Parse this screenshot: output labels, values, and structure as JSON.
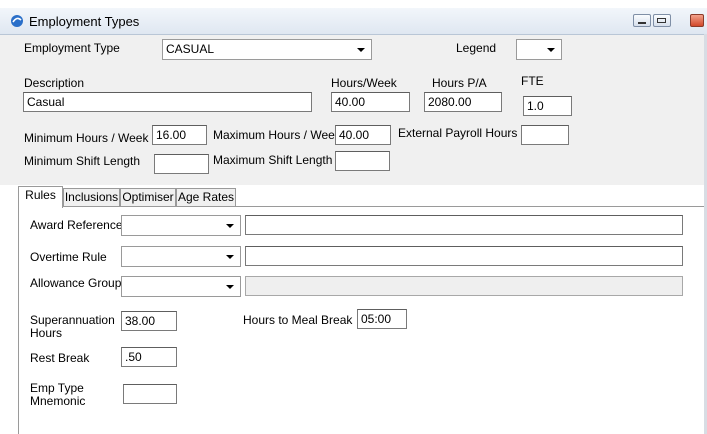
{
  "window": {
    "title": "Employment Types"
  },
  "header": {
    "employment_type_label": "Employment Type",
    "employment_type_value": "CASUAL",
    "legend_label": "Legend",
    "legend_value": "",
    "description_label": "Description",
    "description_value": "Casual",
    "hours_week_label": "Hours/Week",
    "hours_week_value": "40.00",
    "hours_pa_label": "Hours P/A",
    "hours_pa_value": "2080.00",
    "fte_label": "FTE",
    "fte_value": "1.0",
    "min_hours_week_label": "Minimum Hours / Week",
    "min_hours_week_value": "16.00",
    "max_hours_week_label": "Maximum Hours / Week",
    "max_hours_week_value": "40.00",
    "external_payroll_hours_label": "External Payroll Hours",
    "external_payroll_hours_value": "",
    "min_shift_length_label": "Minimum Shift Length",
    "min_shift_length_value": "",
    "max_shift_length_label": "Maximum Shift Length",
    "max_shift_length_value": ""
  },
  "tabs": [
    "Rules",
    "Inclusions",
    "Optimiser",
    "Age Rates"
  ],
  "rules": {
    "award_reference_label": "Award Reference",
    "award_reference_value": "",
    "award_reference_desc": "",
    "overtime_rule_label": "Overtime Rule",
    "overtime_rule_value": "",
    "overtime_rule_desc": "",
    "allowance_group_label": "Allowance Group",
    "allowance_group_value": "",
    "allowance_group_desc": "",
    "superannuation_label_1": "Superannuation",
    "superannuation_label_2": "Hours",
    "superannuation_value": "38.00",
    "hours_to_meal_break_label": "Hours to Meal Break",
    "hours_to_meal_break_value": "05:00",
    "rest_break_label": "Rest Break",
    "rest_break_value": ".50",
    "emp_type_mnemonic_label_1": "Emp Type",
    "emp_type_mnemonic_label_2": "Mnemonic",
    "emp_type_mnemonic_value": ""
  },
  "colors": {
    "form_bg": "#f0f0f0",
    "titlebar": "#dfe7f1",
    "close_button": "#d1482a"
  },
  "icons": [
    "app-icon",
    "minimize-icon",
    "maximize-icon",
    "close-icon",
    "dropdown-arrow-icon"
  ]
}
